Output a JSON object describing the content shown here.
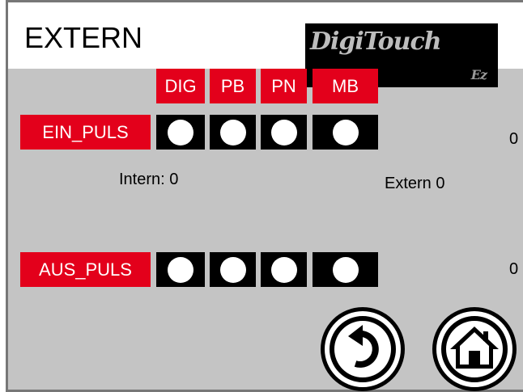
{
  "header": {
    "title": "EXTERN",
    "logo_text": "DigiTouch",
    "logo_sub": "Ez"
  },
  "columns": [
    "DIG",
    "PB",
    "PN",
    "MB"
  ],
  "rows": [
    {
      "label": "EIN_PULS",
      "value": "0"
    },
    {
      "label": "AUS_PULS",
      "value": "0"
    }
  ],
  "status": {
    "intern": "Intern: 0",
    "extern": "Extern 0"
  },
  "buttons": {
    "back_icon": "back-arrow-icon",
    "home_icon": "home-icon"
  },
  "colors": {
    "accent": "#e3001b",
    "panel_bg": "#c4c4c4",
    "indicator_bg": "#000000",
    "indicator_dot": "#ffffff"
  }
}
